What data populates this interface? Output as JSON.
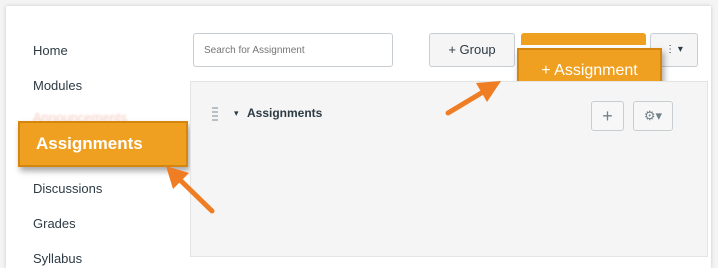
{
  "sidebar": {
    "items": [
      {
        "label": "Home"
      },
      {
        "label": "Modules"
      },
      {
        "label": "Announcements"
      },
      {
        "label": "Assignments"
      },
      {
        "label": "Discussions"
      },
      {
        "label": "Grades"
      },
      {
        "label": "Syllabus"
      }
    ],
    "callout_label": "Assignments"
  },
  "toolbar": {
    "search_placeholder": "Search for Assignment",
    "group_button_label": "+ Group",
    "menu_button_label": "⋮ ▾",
    "callout_label": "+ Assignment"
  },
  "assignment_group": {
    "caret": "▾",
    "title": "Assignments",
    "add_button_label": "+",
    "settings_button_label": "⚙▾"
  },
  "colors": {
    "callout_orange": "#f0a020",
    "arrow_orange": "#ef7d24",
    "text": "#2d3b45"
  }
}
